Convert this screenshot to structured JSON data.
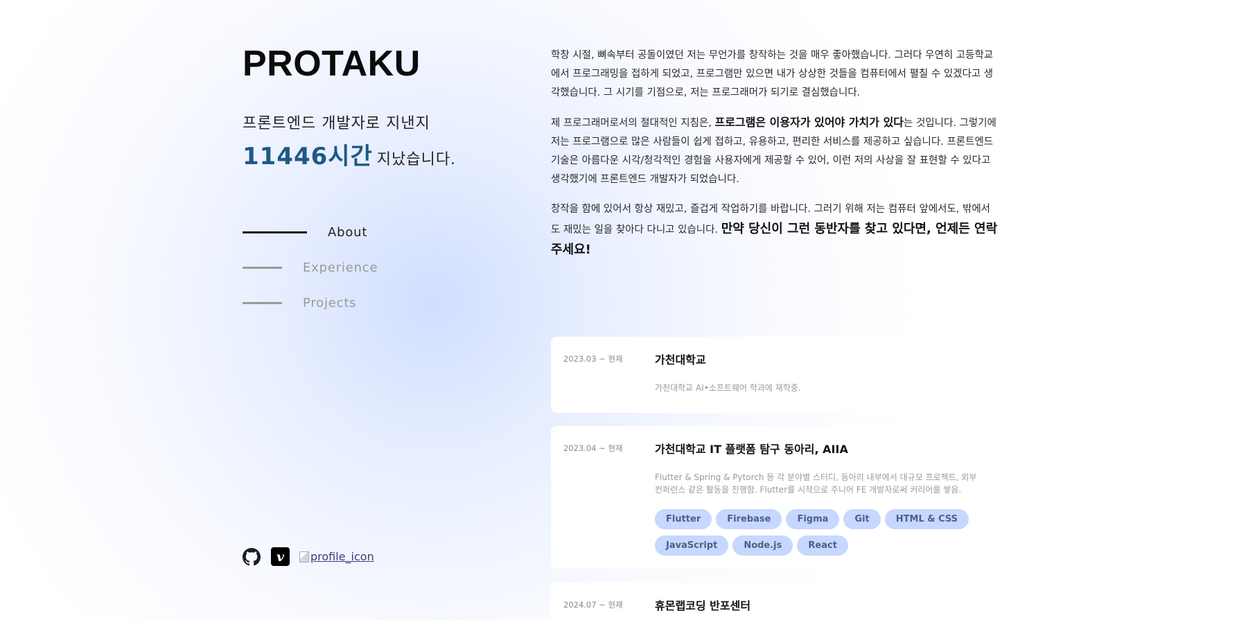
{
  "brand": "PROTAKU",
  "intro": {
    "line1": "프론트엔드 개발자로 지낸지",
    "hours": "11446시간",
    "rest": "지났습니다."
  },
  "nav": {
    "items": [
      {
        "label": "About",
        "active": true
      },
      {
        "label": "Experience",
        "active": false
      },
      {
        "label": "Projects",
        "active": false
      }
    ]
  },
  "social": {
    "github_icon": "github-icon",
    "velog_icon": "velog-icon",
    "velog_letter": "v",
    "profile_alt": "profile_icon"
  },
  "about": {
    "p1": "학창 시절, 뼈속부터 공돌이였던 저는 무언가를 창작하는 것을 매우 좋아했습니다. 그러다 우연히 고등학교에서 프로그래밍을 접하게 되었고, 프로그램만 있으면 내가 상상한 것들을 컴퓨터에서 펼칠 수 있겠다고 생각했습니다. 그 시기를 기점으로, 저는 프로그래머가 되기로 결심했습니다.",
    "p2_pre": "제 프로그래머로서의 절대적인 지침은, ",
    "p2_bold": "프로그램은 이용자가 있어야 가치가 있다",
    "p2_post": "는 것입니다. 그렇기에 저는 프로그램으로 많은 사람들이 쉽게 접하고, 유용하고, 편리한 서비스를 제공하고 싶습니다. 프론트엔드 기술은 아름다운 시각/청각적인 경험을 사용자에게 제공할 수 있어, 이런 저의 사상을 잘 표현할 수 있다고 생각했기에 프론트엔드 개발자가 되었습니다.",
    "p3_pre": "창작을 함에 있어서 항상 재밌고, 즐겁게 작업하기를 바랍니다. 그러기 위해 저는 컴퓨터 앞에서도, 밖에서도 재밌는 일을 찾아다 다니고 있습니다. ",
    "p3_bold": "만약 당신이 그런 동반자를 찾고 있다면, 언제든 연락주세요!"
  },
  "experience": [
    {
      "date": "2023.03 ~ 현재",
      "title": "가천대학교",
      "desc": "가천대학교 AI•소프트웨어 학과에 재학중.",
      "tags": []
    },
    {
      "date": "2023.04 ~ 현재",
      "title": "가천대학교 IT 플랫폼 탐구 동아리, AIIA",
      "desc": "Flutter & Spring & Pytorch 등 각 분야별 스터디, 동아리 내부에서 대규모 프로젝트, 외부 컨퍼런스 같은 활동을 진행함. Flutter를 시작으로 주니어 FE 개발자로써 커리어를 쌓음.",
      "tags": [
        "Flutter",
        "Firebase",
        "Figma",
        "Git",
        "HTML & CSS",
        "JavaScript",
        "Node.js",
        "React"
      ]
    },
    {
      "date": "2024.07 ~ 현재",
      "title": "휴몬랩코딩 반포센터",
      "desc": "",
      "tags": []
    }
  ],
  "colors": {
    "accent": "#1e5a86",
    "tag_bg": "#c6d8ff",
    "tag_text": "#4a5f8c"
  }
}
